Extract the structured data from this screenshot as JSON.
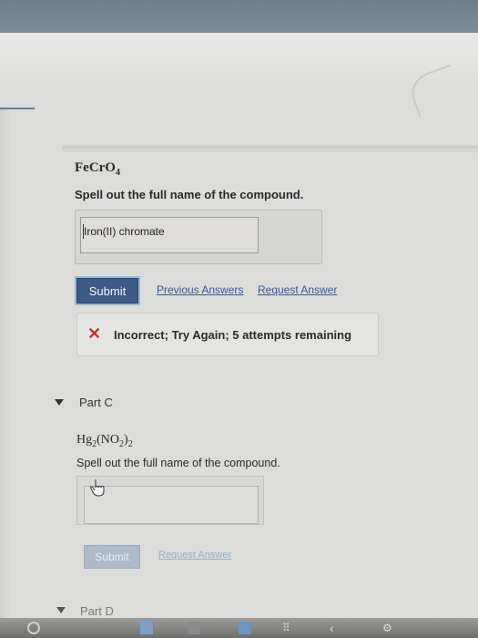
{
  "part_b": {
    "formula": {
      "base": "FeCrO",
      "sub": "4"
    },
    "prompt": "Spell out the full name of the compound.",
    "answer_value": "Iron(II) chromate",
    "submit_label": "Submit",
    "previous_answers_label": "Previous Answers",
    "request_answer_label": "Request Answer",
    "feedback": "Incorrect; Try Again; 5 attempts remaining"
  },
  "part_c": {
    "label": "Part C",
    "formula": {
      "p1": "Hg",
      "s1": "2",
      "p2": "(NO",
      "s2": "2",
      "p3": ")",
      "s3": "2"
    },
    "prompt": "Spell out the full name of the compound.",
    "answer_value": "",
    "submit_label": "Submit",
    "request_answer_label": "Request Answer"
  },
  "part_d": {
    "label": "Part D"
  },
  "colors": {
    "submit": "#3b5a86",
    "link": "#2f5a9e",
    "error": "#c0392b",
    "disabled_submit": "#a7b7c9"
  },
  "icons": [
    "incorrect-x-icon",
    "collapse-triangle-icon",
    "hand-cursor-icon"
  ]
}
